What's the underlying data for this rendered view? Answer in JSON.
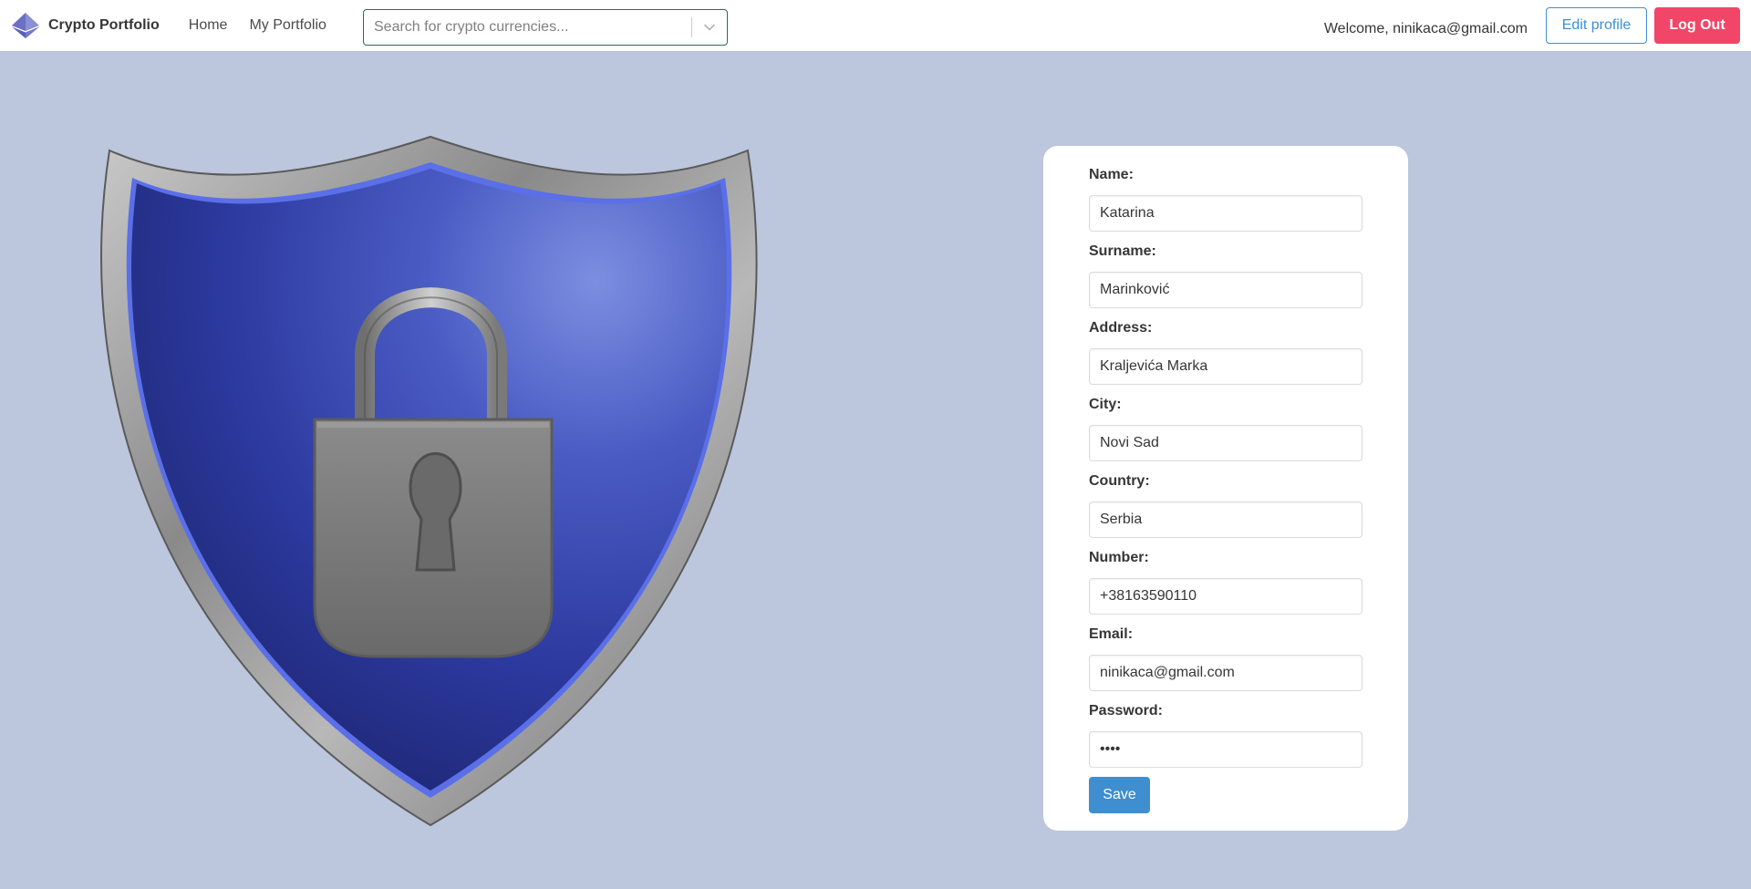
{
  "navbar": {
    "brand": "Crypto Portfolio",
    "links": [
      "Home",
      "My Portfolio"
    ],
    "search_placeholder": "Search for crypto currencies...",
    "welcome": "Welcome, ninikaca@gmail.com",
    "edit_profile": "Edit profile",
    "logout": "Log Out"
  },
  "hero_image": {
    "icon": "shield-lock-icon"
  },
  "form": {
    "fields": [
      {
        "label": "Name:",
        "value": "Katarina",
        "type": "text"
      },
      {
        "label": "Surname:",
        "value": "Marinković",
        "type": "text"
      },
      {
        "label": "Address:",
        "value": "Kraljevića Marka",
        "type": "text"
      },
      {
        "label": "City:",
        "value": "Novi Sad",
        "type": "text"
      },
      {
        "label": "Country:",
        "value": "Serbia",
        "type": "text"
      },
      {
        "label": "Number:",
        "value": "+38163590110",
        "type": "text"
      },
      {
        "label": "Email:",
        "value": "ninikaca@gmail.com",
        "type": "text"
      },
      {
        "label": "Password:",
        "value": "••••",
        "type": "password"
      }
    ],
    "save_label": "Save"
  },
  "colors": {
    "background": "#bcc7dd",
    "primary": "#3e8ed0",
    "danger": "#f14668",
    "shield_blue": "#2f3fa8"
  }
}
